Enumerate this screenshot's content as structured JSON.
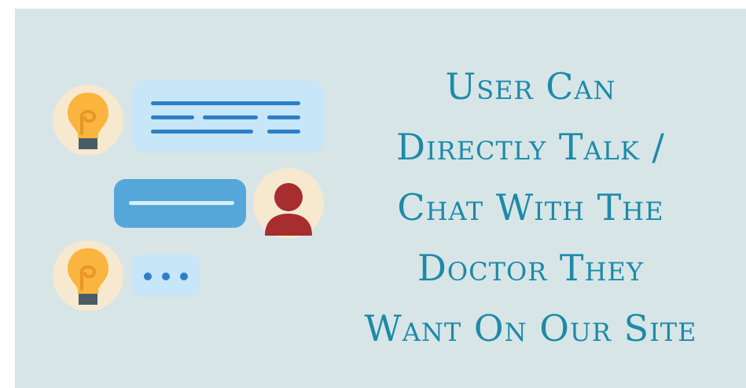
{
  "headline": {
    "lines": [
      "User Can",
      "Directly Talk /",
      "Chat With The",
      "Doctor They",
      "Want On Our Site"
    ]
  },
  "colors": {
    "background": "#d7e5e7",
    "headline": "#1d8aa8",
    "bubble_light": "#c7e6f8",
    "bubble_dark": "#55a7d9",
    "line_blue": "#2e7fc4",
    "avatar_circle": "#f6e9cf",
    "avatar_person": "#a72d2f",
    "bulb_fill": "#f9b53d",
    "bulb_base": "#4a5c66"
  },
  "icons": [
    "lightbulb-icon",
    "chat-bubble-icon",
    "user-avatar-icon",
    "typing-dots-icon"
  ]
}
